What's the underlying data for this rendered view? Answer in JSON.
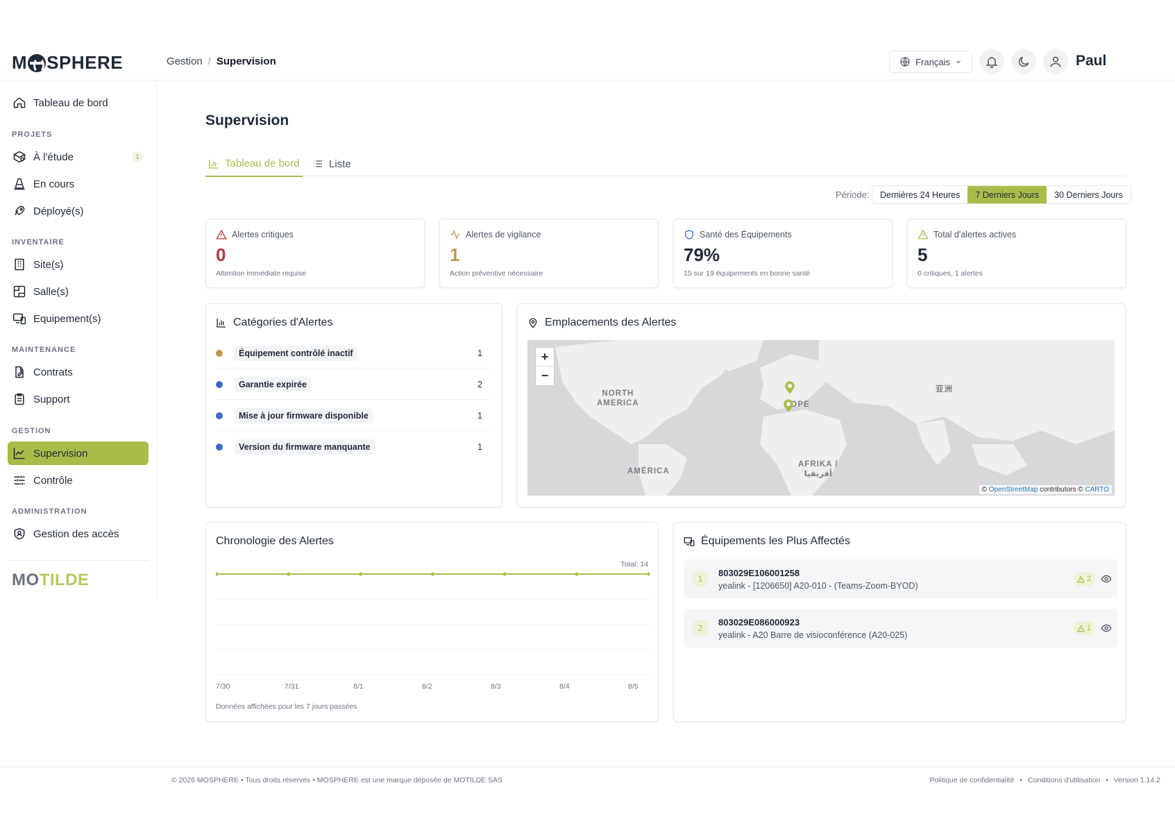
{
  "brand": {
    "logo_pre": "M",
    "logo_post": "SPHERE",
    "footer_logo_a": "MO",
    "footer_logo_b": "TILDE"
  },
  "header": {
    "breadcrumb": [
      "Gestion",
      "/",
      "Supervision"
    ],
    "language": "Français",
    "user": "Paul"
  },
  "sidebar": {
    "top_item": "Tableau de bord",
    "sections": {
      "projets": "PROJETS",
      "inventaire": "INVENTAIRE",
      "maintenance": "MAINTENANCE",
      "gestion": "GESTION",
      "administration": "ADMINISTRATION"
    },
    "items": {
      "etude": "À l'étude",
      "etude_badge": "1",
      "encours": "En cours",
      "deployes": "Déployé(s)",
      "sites": "Site(s)",
      "salles": "Salle(s)",
      "equipements": "Equipement(s)",
      "contrats": "Contrats",
      "support": "Support",
      "supervision": "Supervision",
      "controle": "Contrôle",
      "acces": "Gestion des accès"
    }
  },
  "main": {
    "title": "Supervision",
    "tabs": [
      "Tableau de bord",
      "Liste"
    ],
    "period_label": "Période:",
    "periods": [
      "Dernières 24 Heures",
      "7 Derniers Jours",
      "30 Derniers Jours"
    ],
    "active_period_index": 1
  },
  "kpis": [
    {
      "title": "Alertes critiques",
      "value": "0",
      "sub": "Attention immédiate requise",
      "color": "#b33a3a"
    },
    {
      "title": "Alertes de vigilance",
      "value": "1",
      "sub": "Action préventive nécessaire",
      "color": "#c19a4a"
    },
    {
      "title": "Santé des Équipements",
      "value": "79%",
      "sub": "15 sur 19 équipements en bonne santé",
      "color": "#1f2937"
    },
    {
      "title": "Total d'alertes actives",
      "value": "5",
      "sub": "0 critiques, 1 alertes",
      "color": "#1f2937"
    }
  ],
  "categories": {
    "title": "Catégories d'Alertes",
    "items": [
      {
        "label": "Équipement contrôlé inactif",
        "count": "1",
        "color": "#c19a4a"
      },
      {
        "label": "Garantie expirée",
        "count": "2",
        "color": "#3b6cc4"
      },
      {
        "label": "Mise à jour firmware disponible",
        "count": "1",
        "color": "#3b6cc4"
      },
      {
        "label": "Version du firmware manquante",
        "count": "1",
        "color": "#3b6cc4"
      }
    ]
  },
  "map": {
    "title": "Emplacements des Alertes",
    "zoom_in": "+",
    "zoom_out": "−",
    "labels": {
      "north_america_1": "NORTH",
      "north_america_2": "AMERICA",
      "europe": "ROPE",
      "asia": "亚洲",
      "south_america": "AMÉRICA",
      "africa_1": "AFRIKA /",
      "africa_2": "أفريقيا"
    },
    "attribution": {
      "prefix": "©",
      "osm": "OpenStreetMap",
      "mid": "contributors ©",
      "carto": "CARTO"
    }
  },
  "timeline": {
    "title": "Chronologie des Alertes",
    "total": "Total: 14",
    "note": "Données affichées pour les 7 jours passées"
  },
  "chart_data": {
    "type": "line",
    "title": "Chronologie des Alertes",
    "categories": [
      "7/30",
      "7/31",
      "8/1",
      "8/2",
      "8/3",
      "8/4",
      "8/5"
    ],
    "series": [
      {
        "values": [
          2,
          2,
          2,
          2,
          2,
          2,
          2
        ]
      }
    ],
    "ylim": [
      0,
      2
    ],
    "grid": true,
    "annotation": "Total: 14"
  },
  "equipment": {
    "title": "Équipements les Plus Affectés",
    "items": [
      {
        "rank": "1",
        "id": "803029E106001258",
        "desc": "yealink - [1206650] A20-010 - (Teams-Zoom-BYOD)",
        "alerts": "2"
      },
      {
        "rank": "2",
        "id": "803029E086000923",
        "desc": "yealink - A20 Barre de visioconférence (A20-025)",
        "alerts": "1"
      }
    ]
  },
  "footer": {
    "left": "© 2026 MOSPHERE • Tous droits réservés • MOSPHERE est une marque déposée de MOTILDE SAS",
    "privacy": "Politique de confidentialité",
    "terms": "Conditions d'utilisation",
    "version": "Version 1.14.2",
    "sep": "•"
  },
  "colors": {
    "accent": "#a9bc4a",
    "critical": "#b33a3a",
    "warning": "#c19a4a",
    "info": "#3b6cc4"
  }
}
